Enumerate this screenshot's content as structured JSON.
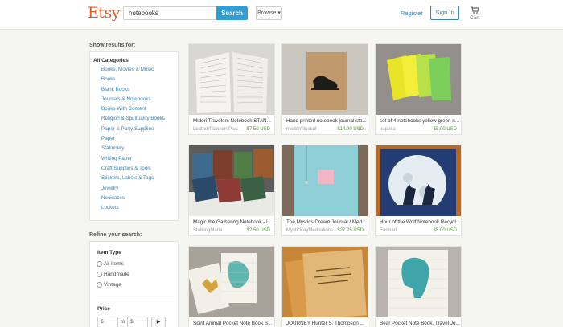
{
  "header": {
    "logo": "Etsy",
    "search_value": "notebooks",
    "search_button": "Search",
    "browse": "Browse ▾",
    "register": "Register",
    "sign_in": "Sign In",
    "cart": "Cart"
  },
  "sidebar": {
    "show_results_for": "Show results for:",
    "all_categories": "All Categories",
    "categories": [
      "Books, Movies & Music",
      "Books",
      "Blank Books",
      "Journals & Notebooks",
      "Books With Content",
      "Religion & Spirituality Books",
      "Paper & Party Supplies",
      "Paper",
      "Stationery",
      "Writing Paper",
      "Craft Supplies & Tools",
      "Stickers, Labels & Tags",
      "Jewelry",
      "Necklaces",
      "Lockets"
    ],
    "refine_heading": "Refine your search:",
    "item_type_title": "Item Type",
    "item_types": [
      "All Items",
      "Handmade",
      "Vintage"
    ],
    "price_title": "Price",
    "price_min": "$",
    "price_to": "to",
    "price_max": "$",
    "price_go": "▶"
  },
  "listings": [
    {
      "title": "Midori Travelers Notebook STAN...",
      "shop": "LeatherPlannersPlus",
      "price": "$7.50 USD",
      "image": "open-notebook-pages"
    },
    {
      "title": "Hand printed notebook journal sta...",
      "shop": "modernlinocut",
      "price": "$14.00 USD",
      "image": "kraft-notebook-shoe-print"
    },
    {
      "title": "set of 4 notebooks yellow green n...",
      "shop": "pepirsa",
      "price": "$5.00 USD",
      "image": "yellow-green-notebooks"
    },
    {
      "title": "Magic the Gathering Notebook - L...",
      "shop": "StalkingMarla",
      "price": "$2.50 USD",
      "image": "card-notebooks"
    },
    {
      "title": "The Mystics Dream Journal / Med...",
      "shop": "MysticKeyMeditations",
      "price": "$27.25 USD",
      "image": "blue-dream-journal"
    },
    {
      "title": "Hour of the Wolf Notebook Recycl...",
      "shop": "Earmark",
      "price": "$5.00 USD",
      "image": "wolf-moon-notebook"
    },
    {
      "title": "Spirit Animal Pocket Note Book S...",
      "shop": "",
      "price": "",
      "image": "bear-stag-notebooks"
    },
    {
      "title": "JOURNEY Hunter S. Thompson ...",
      "shop": "",
      "price": "",
      "image": "journey-notebook"
    },
    {
      "title": "Bear Pocket Note Book, Travel Jo...",
      "shop": "",
      "price": "",
      "image": "bear-notebook"
    }
  ],
  "colors": {
    "brand": "#e45c1e",
    "link": "#3a84b6",
    "search_button": "#2f9ed6",
    "price": "#4a9a2e"
  }
}
